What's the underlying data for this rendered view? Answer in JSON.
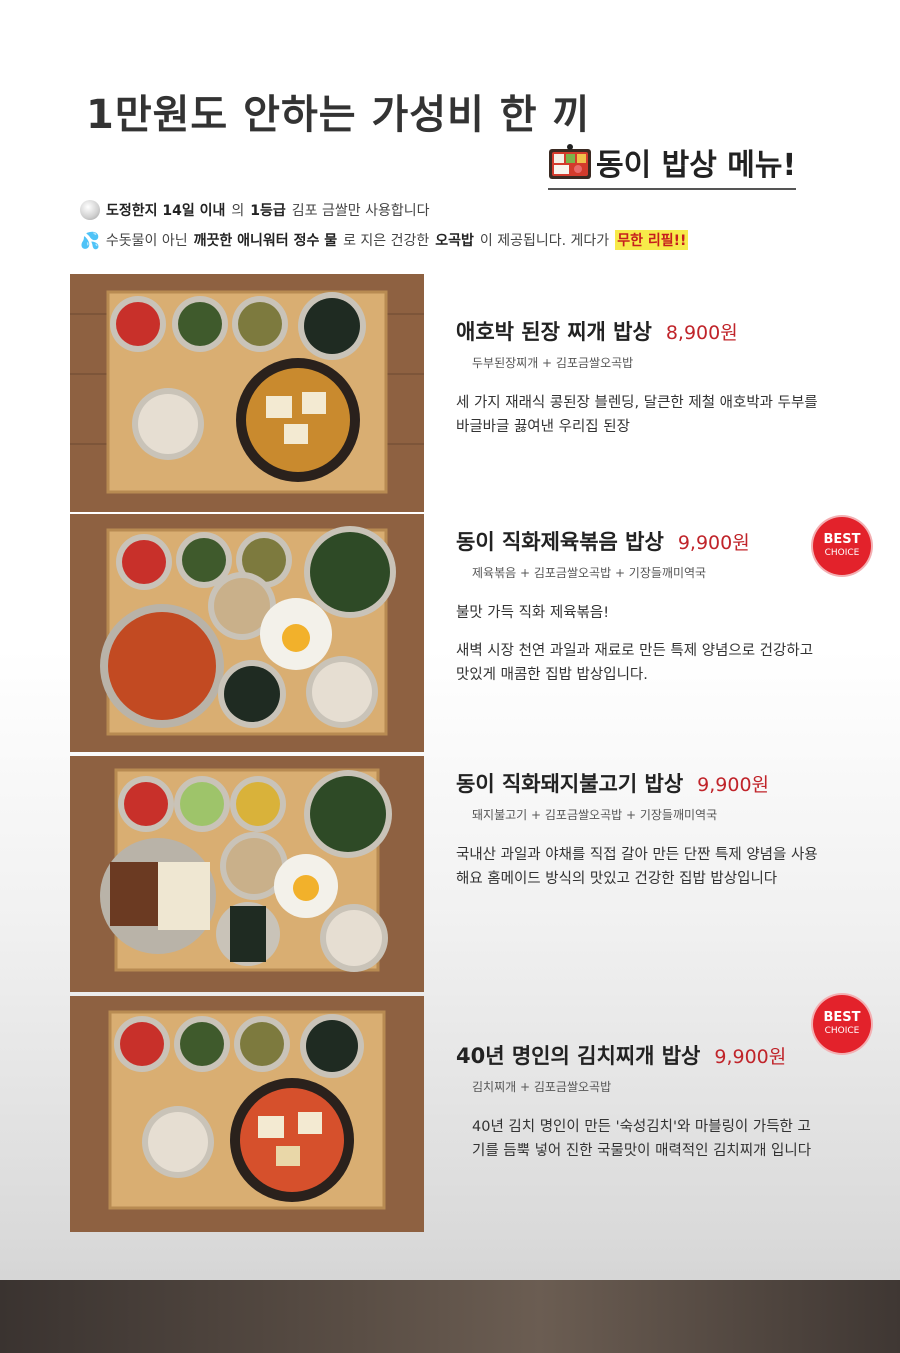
{
  "header": {
    "title": "1만원도 안하는 가성비 한 끼",
    "subtitle": "동이 밥상 메뉴!"
  },
  "notices": [
    {
      "icon": "rice-icon",
      "part1_bold": "도정한지 14일 이내",
      "part2": "의 ",
      "part3_bold": "1등급",
      "part4": " 김포 금쌀만 사용합니다"
    },
    {
      "icon": "water-drop-icon",
      "part1": "수돗물이 아닌 ",
      "part2_bold": "깨끗한 애니워터 정수 물",
      "part3": "로 지은 건강한 ",
      "part4_bold": "오곡밥",
      "part5": "이 제공됩니다. 게다가 ",
      "highlight": "무한 리필!!"
    }
  ],
  "menus": [
    {
      "name": "애호박 된장 찌개 밥상",
      "price": "8,900원",
      "components": "두부된장찌개 + 김포금쌀오곡밥",
      "desc": [
        "세 가지 재래식 콩된장 블렌딩, 달큰한 제철 애호박과 두부를 바글바글 끓여낸 우리집 된장"
      ],
      "best": false
    },
    {
      "name": "동이 직화제육볶음 밥상",
      "price": "9,900원",
      "components": "제육볶음 + 김포금쌀오곡밥 + 기장들깨미역국",
      "desc": [
        "불맛 가득 직화 제육볶음!",
        "새벽 시장 천연 과일과 재료로 만든 특제 양념으로 건강하고 맛있게 매콤한 집밥 밥상입니다."
      ],
      "best": true
    },
    {
      "name": "동이 직화돼지불고기 밥상",
      "price": "9,900원",
      "components": "돼지불고기 + 김포금쌀오곡밥 + 기장들깨미역국",
      "desc": [
        "국내산 과일과 야채를 직접 갈아 만든 단짠 특제 양념을 사용해요 홈메이드 방식의 맛있고 건강한 집밥 밥상입니다"
      ],
      "best": false
    },
    {
      "name": "40년 명인의 김치찌개 밥상",
      "price": "9,900원",
      "components": "김치찌개 + 김포금쌀오곡밥",
      "desc": [
        "40년 김치 명인이 만든 '숙성김치'와 마블링이 가득한 고기를 듬뿍 넣어 진한 국물맛이 매력적인 김치찌개 입니다"
      ],
      "best": true
    }
  ],
  "badge": {
    "line1": "BEST",
    "line2": "CHOICE"
  },
  "colors": {
    "price": "#c0242a",
    "badge": "#e3222b",
    "highlight": "#f7ea4a"
  }
}
